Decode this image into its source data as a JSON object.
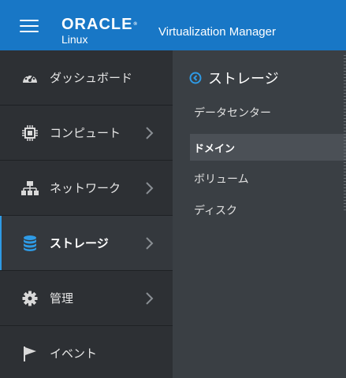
{
  "header": {
    "brand": "ORACLE",
    "brand_mark": "®",
    "brand_sub": "Linux",
    "app_title": "Virtualization Manager"
  },
  "sidebar": {
    "items": [
      {
        "label": "ダッシュボード",
        "icon": "dashboard-icon",
        "has_chevron": false,
        "active": false
      },
      {
        "label": "コンピュート",
        "icon": "chip-icon",
        "has_chevron": true,
        "active": false
      },
      {
        "label": "ネットワーク",
        "icon": "network-icon",
        "has_chevron": true,
        "active": false
      },
      {
        "label": "ストレージ",
        "icon": "database-icon",
        "has_chevron": true,
        "active": true
      },
      {
        "label": "管理",
        "icon": "gear-icon",
        "has_chevron": true,
        "active": false
      },
      {
        "label": "イベント",
        "icon": "flag-icon",
        "has_chevron": false,
        "active": false
      }
    ]
  },
  "panel": {
    "title": "ストレージ",
    "items": [
      {
        "label": "データセンター",
        "selected": false
      },
      {
        "label": "ドメイン",
        "selected": true
      },
      {
        "label": "ボリューム",
        "selected": false
      },
      {
        "label": "ディスク",
        "selected": false
      }
    ]
  },
  "colors": {
    "header_bg": "#1877c6",
    "sidebar_bg": "#2d3034",
    "panel_bg": "#3a3f44",
    "accent": "#2e9be6",
    "selected_bg": "#4b5056"
  }
}
